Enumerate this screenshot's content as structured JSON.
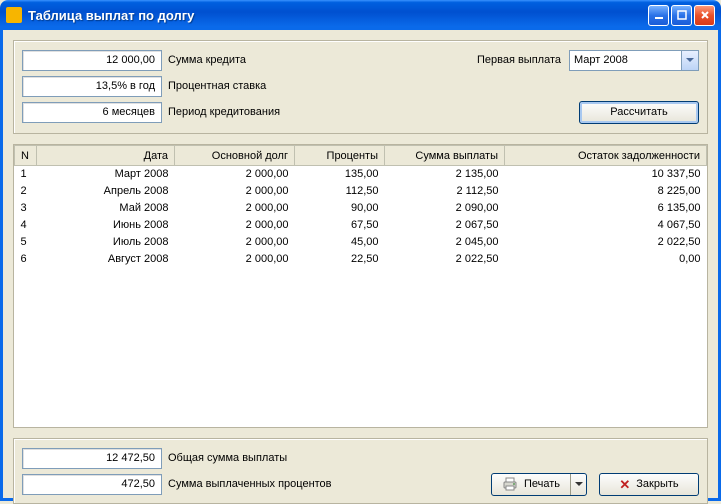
{
  "window": {
    "title": "Таблица выплат по долгу"
  },
  "params": {
    "amount": "12 000,00",
    "amount_label": "Сумма кредита",
    "rate": "13,5% в год",
    "rate_label": "Процентная ставка",
    "period": "6 месяцев",
    "period_label": "Период кредитования",
    "first_payment_label": "Первая выплата",
    "first_payment_value": "Март 2008",
    "calc_button": "Рассчитать"
  },
  "table": {
    "headers": {
      "n": "N",
      "date": "Дата",
      "principal": "Основной долг",
      "interest": "Проценты",
      "payment": "Сумма выплаты",
      "balance": "Остаток задолженности"
    },
    "rows": [
      {
        "n": "1",
        "date": "Март 2008",
        "principal": "2 000,00",
        "interest": "135,00",
        "payment": "2 135,00",
        "balance": "10 337,50"
      },
      {
        "n": "2",
        "date": "Апрель 2008",
        "principal": "2 000,00",
        "interest": "112,50",
        "payment": "2 112,50",
        "balance": "8 225,00"
      },
      {
        "n": "3",
        "date": "Май 2008",
        "principal": "2 000,00",
        "interest": "90,00",
        "payment": "2 090,00",
        "balance": "6 135,00"
      },
      {
        "n": "4",
        "date": "Июнь 2008",
        "principal": "2 000,00",
        "interest": "67,50",
        "payment": "2 067,50",
        "balance": "4 067,50"
      },
      {
        "n": "5",
        "date": "Июль 2008",
        "principal": "2 000,00",
        "interest": "45,00",
        "payment": "2 045,00",
        "balance": "2 022,50"
      },
      {
        "n": "6",
        "date": "Август 2008",
        "principal": "2 000,00",
        "interest": "22,50",
        "payment": "2 022,50",
        "balance": "0,00"
      }
    ]
  },
  "totals": {
    "total_payment": "12 472,50",
    "total_payment_label": "Общая сумма выплаты",
    "total_interest": "472,50",
    "total_interest_label": "Сумма выплаченных процентов"
  },
  "buttons": {
    "print": "Печать",
    "close": "Закрыть"
  }
}
